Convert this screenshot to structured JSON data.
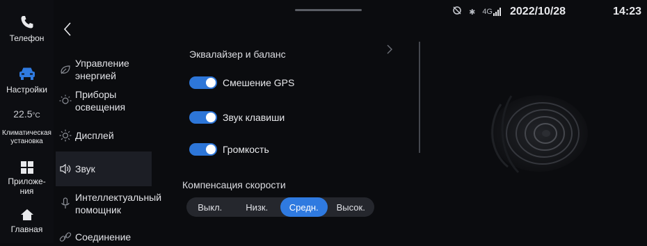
{
  "status": {
    "date": "2022/10/28",
    "time": "14:23",
    "network": "4G"
  },
  "dock": [
    {
      "label": "Телефон",
      "icon": "phone-icon"
    },
    {
      "label": "Настройки",
      "icon": "car-icon"
    },
    {
      "temp": "22.5",
      "unit": "°C",
      "label": "Климатическая установка"
    },
    {
      "label": "Приложе-\nния",
      "icon": "apps-icon"
    },
    {
      "label": "Главная",
      "icon": "home-icon"
    }
  ],
  "menu": [
    {
      "label": "Управление энергией",
      "icon": "leaf-icon"
    },
    {
      "label": "Приборы освещения",
      "icon": "light-icon"
    },
    {
      "label": "Дисплей",
      "icon": "sun-icon"
    },
    {
      "label": "Звук",
      "icon": "speaker-icon"
    },
    {
      "label": "Интеллектуальный помощник",
      "icon": "microphone-icon"
    },
    {
      "label": "Соединение",
      "icon": "link-icon"
    }
  ],
  "content": {
    "equalizer_title": "Эквалайзер и баланс",
    "toggles": [
      {
        "label": "Смешение GPS",
        "on": true
      },
      {
        "label": "Звук клавиши",
        "on": true
      },
      {
        "label": "Громкость",
        "on": true
      }
    ],
    "speed_comp_title": "Компенсация скорости",
    "speed_options": [
      "Выкл.",
      "Низк.",
      "Средн.",
      "Высок."
    ],
    "speed_selected": "Средн."
  },
  "colors": {
    "accent": "#2f7ae0",
    "background": "#0b0c0f"
  }
}
